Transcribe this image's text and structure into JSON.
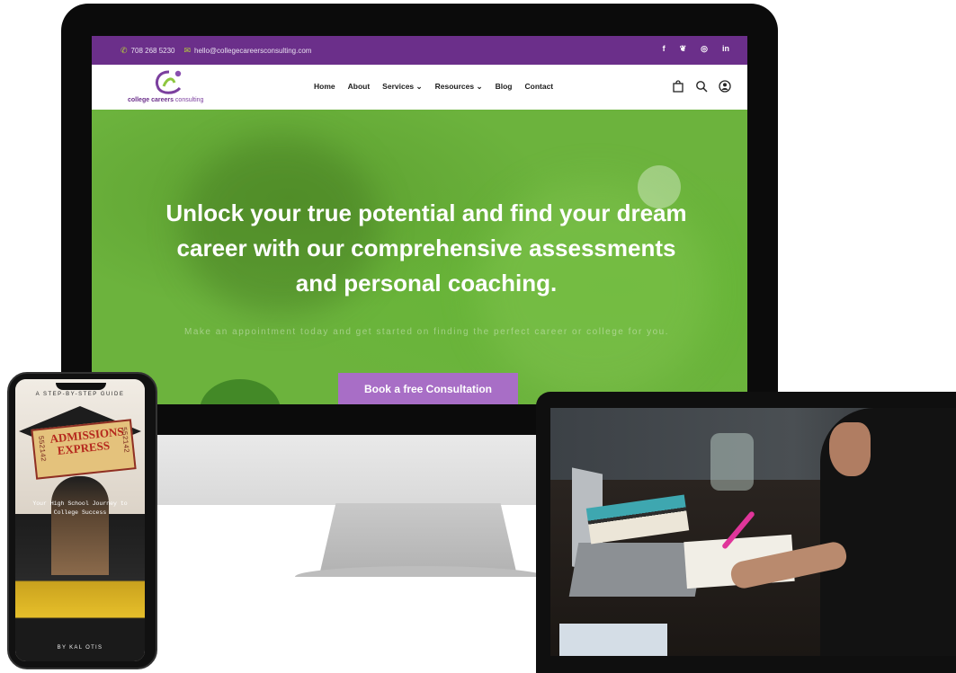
{
  "site": {
    "topbar": {
      "phone": "708 268 5230",
      "email": "hello@collegecareersconsulting.com",
      "social_icons": [
        "facebook-icon",
        "twitter-icon",
        "instagram-icon",
        "linkedin-icon"
      ],
      "social_glyphs": [
        "f",
        "❦",
        "◎",
        "in"
      ]
    },
    "logo": {
      "word1": "college careers",
      "word2": " consulting"
    },
    "nav": {
      "items": [
        "Home",
        "About",
        "Services ⌄",
        "Resources ⌄",
        "Blog",
        "Contact"
      ]
    },
    "hero": {
      "headline": "Unlock your true potential and find your dream career with our comprehensive assessments and personal coaching.",
      "subtext": "Make an appointment today and get started on finding the perfect career or college for you.",
      "cta": "Book a free Consultation"
    },
    "colors": {
      "topbar": "#6b2f8a",
      "hero": "#6cb33d",
      "cta": "#a86ec6",
      "accent_green": "#b6d33a"
    }
  },
  "phone_book": {
    "tagline": "A STEP-BY-STEP GUIDE",
    "ticket_title": "ADMISSIONS EXPRESS",
    "ticket_number": "552142",
    "subtitle": "Your High School Journey to College Success",
    "author": "BY KAL OTIS"
  }
}
